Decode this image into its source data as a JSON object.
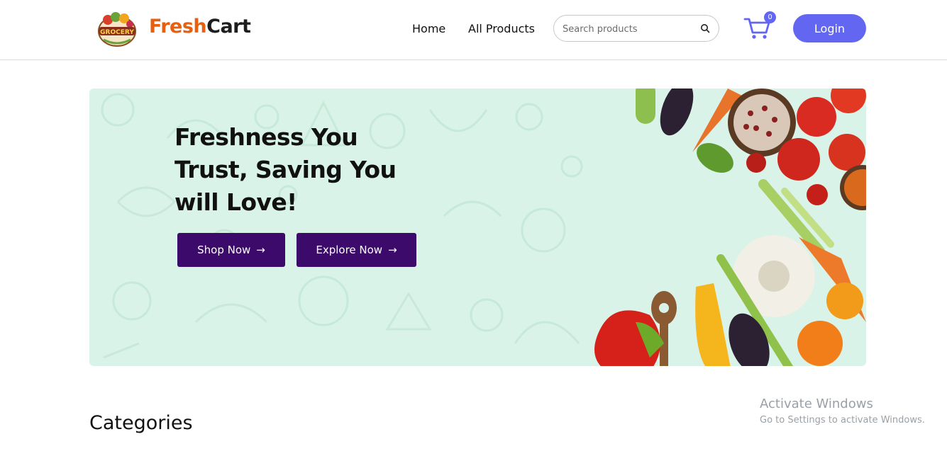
{
  "header": {
    "logo_text": "GROCERY",
    "brand_part1": "Fresh",
    "brand_part2": "Cart",
    "nav": {
      "home": "Home",
      "all_products": "All Products"
    },
    "search": {
      "placeholder": "Search products",
      "value": ""
    },
    "cart_count": "0",
    "login_label": "Login"
  },
  "hero": {
    "title_line1": "Freshness You",
    "title_line2": "Trust, Saving You",
    "title_line3": "will Love!",
    "shop_button": "Shop Now",
    "explore_button": "Explore Now",
    "arrow": "→"
  },
  "main": {
    "categories_title": "Categories"
  },
  "watermark": {
    "line1": "Activate Windows",
    "line2": "Go to Settings to activate Windows."
  },
  "colors": {
    "brand_orange": "#e8600f",
    "accent": "#6366f1",
    "hero_bg": "#d9f3e8",
    "hero_button": "#3b0a6b"
  }
}
